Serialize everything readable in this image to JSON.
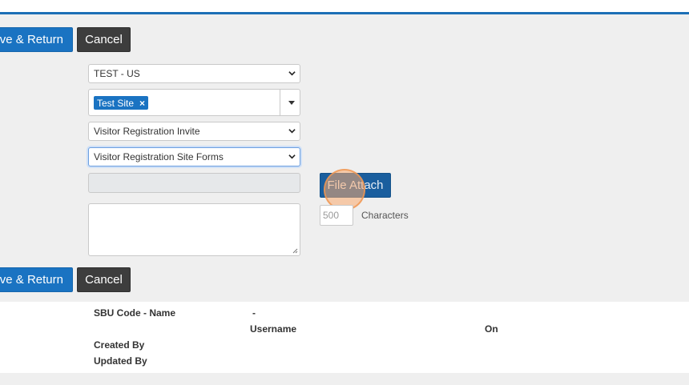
{
  "toolbar_top": {
    "save_return_label": "Save & Return",
    "cancel_label": "Cancel"
  },
  "form": {
    "company_select": "TEST - US",
    "site_tag": "Test Site",
    "site_tag_remove": "×",
    "invite_template_select": "Visitor Registration Invite",
    "site_forms_select": "Visitor Registration Site Forms",
    "file_attach_label": "File Attach",
    "char_limit": "500",
    "characters_label": "Characters"
  },
  "toolbar_bottom": {
    "save_return_label": "Save & Return",
    "cancel_label": "Cancel"
  },
  "info": {
    "sbu_label": "SBU Code - Name",
    "sbu_value": "-",
    "username_header": "Username",
    "on_header": "On",
    "created_by_label": "Created By",
    "updated_by_label": "Updated By"
  },
  "colors": {
    "primary": "#1a73c2",
    "dark": "#3d3d3d",
    "accent_bar": "#1c6fb6"
  }
}
